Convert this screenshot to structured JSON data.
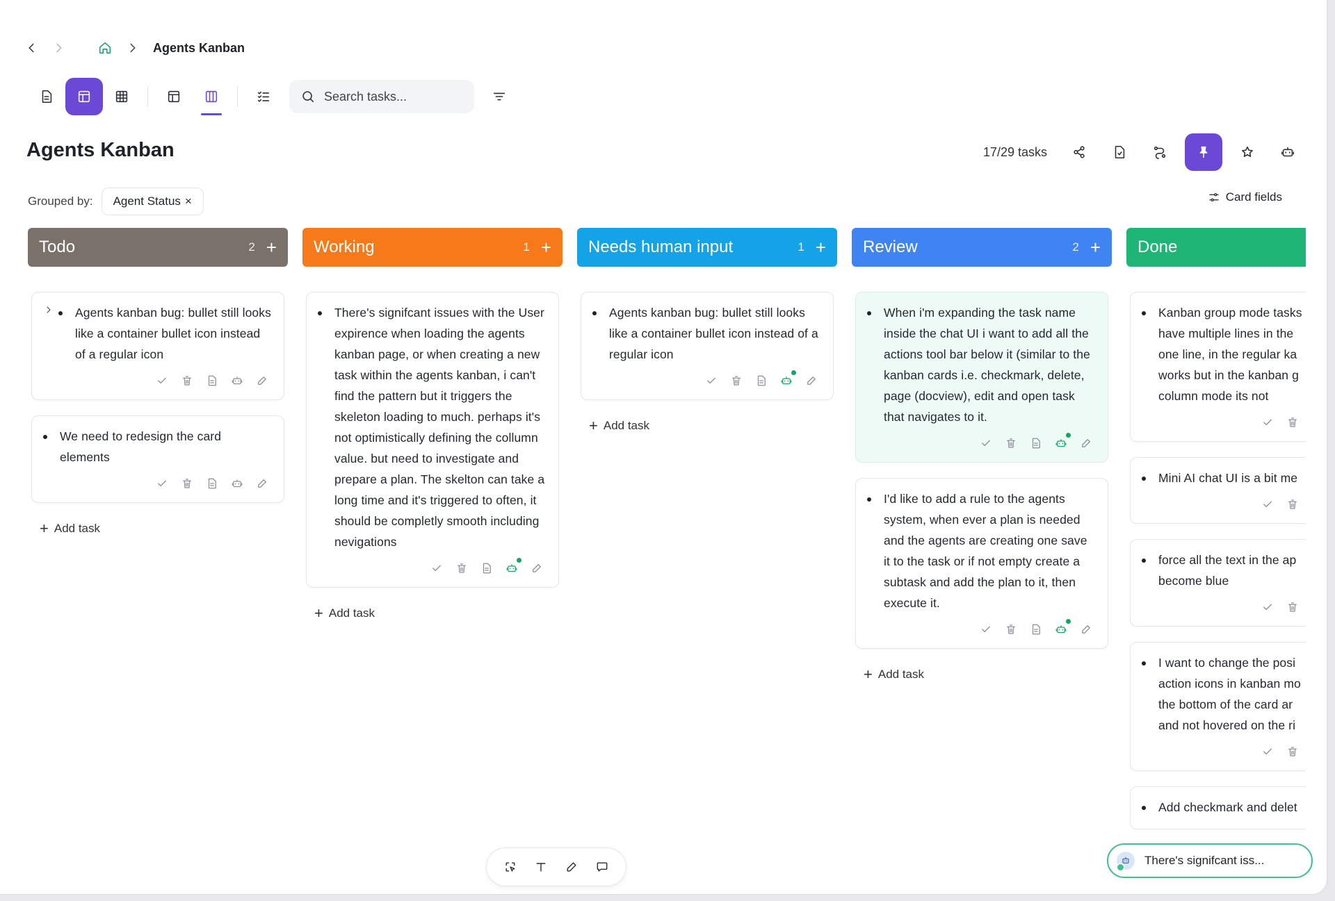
{
  "breadcrumb": {
    "back_icon": "chevron-left-icon",
    "forward_icon": "chevron-right-icon",
    "home_icon": "home-icon",
    "title": "Agents Kanban"
  },
  "toolbar": {
    "views": [
      "document-view",
      "board-view",
      "grid-view",
      "table-view",
      "kanban-view",
      "checklist-view"
    ],
    "active_view": "board-view",
    "search_placeholder": "Search tasks..."
  },
  "page": {
    "title": "Agents Kanban",
    "task_count": "17/29 tasks"
  },
  "grouping": {
    "label": "Grouped by:",
    "value": "Agent Status",
    "remove": "×",
    "card_fields_label": "Card fields"
  },
  "colors": {
    "accent": "#6b49d6",
    "todo": "#7a716b",
    "working": "#f67a1a",
    "needs_input": "#13a3e6",
    "review": "#3f84f3",
    "done": "#1db676",
    "agent_active": "#17a467"
  },
  "columns": [
    {
      "name": "Todo",
      "count": "2",
      "add": "+",
      "cards": [
        {
          "text": "Agents kanban bug: bullet still looks like a container bullet icon instead of a regular icon",
          "expandable": true,
          "agent_active": false
        },
        {
          "text": "We need to redesign the card elements",
          "expandable": false,
          "agent_active": false
        }
      ],
      "add_task": "Add task"
    },
    {
      "name": "Working",
      "count": "1",
      "add": "+",
      "cards": [
        {
          "text": "There's signifcant issues with the User expirence when loading the agents kanban page, or when creating a new task within the agents kanban, i can't find the pattern but it triggers the skeleton loading to much. perhaps it's not optimistically defining the collumn value. but need to investigate and prepare a plan. The skelton can take a long time and it's triggered to often, it should be completly smooth including nevigations",
          "expandable": false,
          "agent_active": true
        }
      ],
      "add_task": "Add task"
    },
    {
      "name": "Needs human input",
      "count": "1",
      "add": "+",
      "cards": [
        {
          "text": "Agents kanban bug: bullet still looks like a container bullet icon instead of a regular icon",
          "expandable": false,
          "agent_active": true
        }
      ],
      "add_task": "Add task"
    },
    {
      "name": "Review",
      "count": "2",
      "add": "+",
      "cards": [
        {
          "text": "When i'm expanding the task name inside the chat UI i want to add all the actions tool bar below it (similar to the kanban cards i.e. checkmark, delete, page (docview), edit and open task that navigates to it.",
          "expandable": false,
          "agent_active": true,
          "highlight": true
        },
        {
          "text": "I'd like to add a rule to the agents system, when ever a plan is needed and the agents are creating one save it to the task or if not empty create a subtask and add the plan to it, then execute it.",
          "expandable": false,
          "agent_active": true
        }
      ],
      "add_task": "Add task"
    },
    {
      "name": "Done",
      "count": "",
      "add": "",
      "cards": [
        {
          "text": "Kanban group mode tasks have multiple lines in the one line, in the regular ka works but in the kanban g column mode its not"
        },
        {
          "text": "Mini AI chat UI is a bit me"
        },
        {
          "text": "force all the text in the ap become blue"
        },
        {
          "text": "I want to change the posi action icons in kanban mo the bottom of the card ar and not hovered on the ri"
        },
        {
          "text": "Add checkmark and delet"
        }
      ]
    }
  ],
  "bottom_toolbar": {
    "tools": [
      "select-tool-icon",
      "text-tool-icon",
      "pen-tool-icon",
      "comment-tool-icon"
    ]
  },
  "chat_pill": {
    "text": "There's signifcant iss..."
  }
}
